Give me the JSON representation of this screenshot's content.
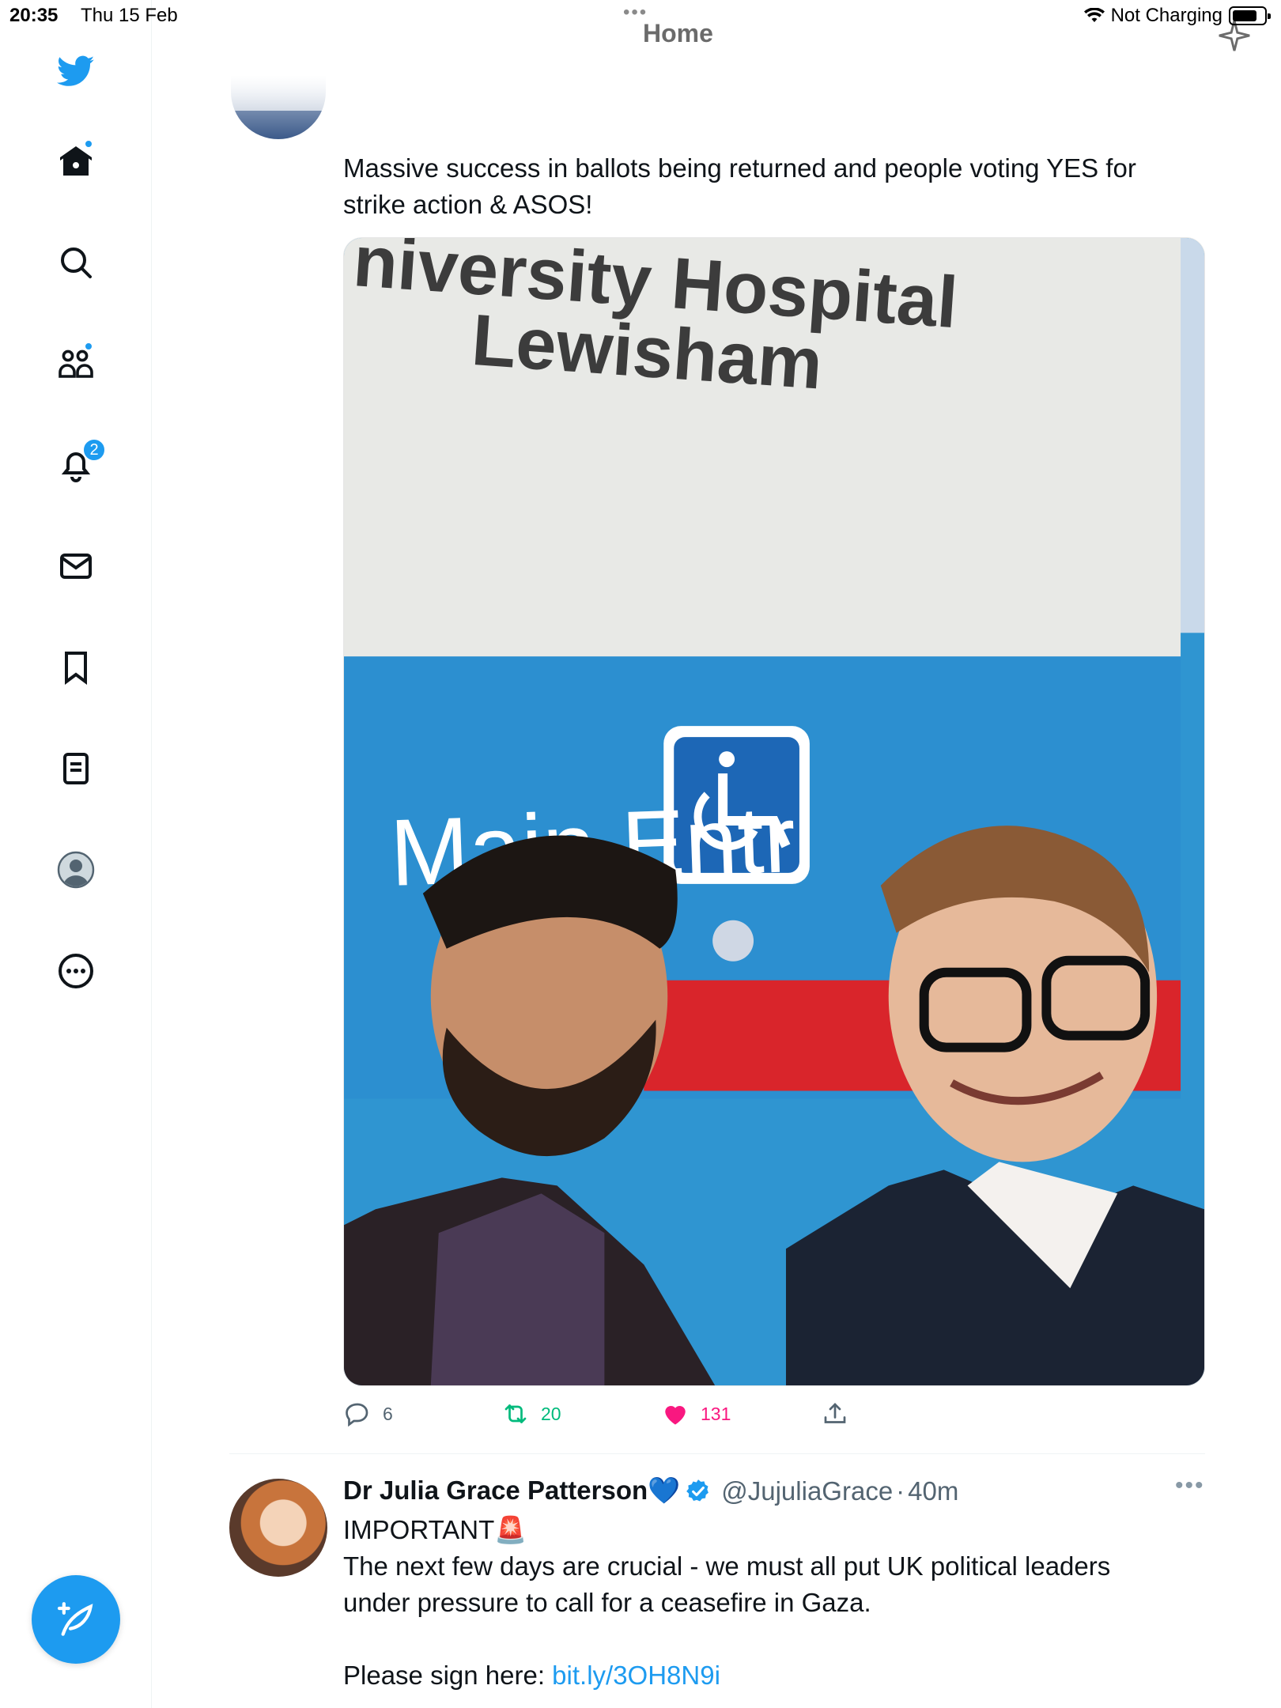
{
  "status_bar": {
    "time": "20:35",
    "date": "Thu 15 Feb",
    "charging": "Not Charging"
  },
  "header": {
    "title": "Home"
  },
  "sidebar": {
    "items": [
      {
        "icon": "twitter-bird-icon"
      },
      {
        "icon": "home-icon",
        "badge_dot": true
      },
      {
        "icon": "search-icon"
      },
      {
        "icon": "communities-icon",
        "badge_dot": true
      },
      {
        "icon": "bell-icon",
        "badge_count": "2"
      },
      {
        "icon": "mail-icon"
      },
      {
        "icon": "bookmark-icon"
      },
      {
        "icon": "lists-icon"
      },
      {
        "icon": "profile-icon"
      },
      {
        "icon": "more-icon"
      }
    ],
    "compose_icon": "compose-feather-icon"
  },
  "tweet1": {
    "text_line1": "Massive success in ballots being returned and people voting YES for",
    "text_line2": "strike action & ASOS!",
    "image": {
      "sign_line1": "niversity Hospital",
      "sign_line2": "Lewisham",
      "sign_line3": "Main Entr"
    },
    "replies": "6",
    "retweets": "20",
    "likes": "131"
  },
  "tweet2": {
    "name": "Dr Julia Grace Patterson💙",
    "handle": "@JujuliaGrace",
    "time": "40m",
    "line1": "IMPORTANT🚨",
    "line2": "The next few days are crucial - we must all put UK political leaders",
    "line3": "under pressure to call for a ceasefire in Gaza.",
    "sign_prefix": "Please sign here: ",
    "link": "bit.ly/3OH8N9i"
  },
  "colors": {
    "brand": "#1d9bf0",
    "retweet": "#00ba7c",
    "like": "#f91880"
  }
}
